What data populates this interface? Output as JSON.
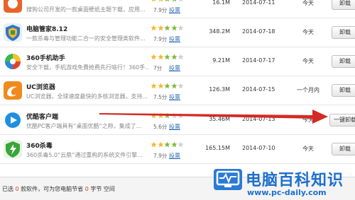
{
  "colors": {
    "accent_blue": "#1d6fce",
    "arrow_red": "#d42a23",
    "star_gold": "#f1b82d",
    "star_green": "#7dbb3a",
    "star_gray": "#cfcfcf",
    "vote_link": "#2e6bb5"
  },
  "apps": [
    {
      "icon": "sogou-browser-icon",
      "name": "",
      "desc": "搜狗公司开发的一款桌面壁纸主题下载，应用...",
      "score": "7.9分",
      "vote": "投票",
      "rating": 4,
      "size": "16.1M",
      "date": "2014-07-11",
      "last_used": "今天",
      "action": "卸载"
    },
    {
      "icon": "pc-manager-icon",
      "name": "电脑管家8.12",
      "desc": "一款杀毒与管理功能二合一的安全管理类软件...",
      "score": "7.9分",
      "vote": "投票",
      "rating": 4,
      "size": "348.2M",
      "date": "2014-07-18",
      "last_used": "今天",
      "action": "卸载"
    },
    {
      "icon": "360-mobile-assistant-icon",
      "name": "360手机助手",
      "desc": "安全下载，手机游戏免費抢费先行啥行！360手...",
      "score": "7分",
      "vote": "投票",
      "rating": 4,
      "size": "9.21M",
      "date": "2014-07-17",
      "last_used": "今天",
      "action": "卸载"
    },
    {
      "icon": "uc-browser-icon",
      "name": "UC浏览器",
      "desc": "UC浏览器，全球速度最快的多核浏览器，支持...",
      "score": "7.5分",
      "vote": "投票",
      "rating": 4,
      "size": "126.3M",
      "date": "2014-07-15",
      "last_used": "一个月内",
      "action": "卸载"
    },
    {
      "icon": "youku-client-icon",
      "name": "优酷客户端",
      "desc": "优酷PC客户端具有“桌面优酷”之称，集成了...",
      "score": "5.6分",
      "vote": "投票",
      "rating": 3,
      "size": "35.46M",
      "date": "2014-07-13",
      "last_used": "今天",
      "action": "一键卸载"
    },
    {
      "icon": "360-antivirus-icon",
      "name": "360杀毒",
      "desc": "360杀毒5.0“云鼎”通过重构的系统文件引擎...",
      "score": "7.9分",
      "vote": "投票",
      "rating": 4,
      "size": "165.15M",
      "date": "2014-07-10",
      "last_used": "今天",
      "action": "卸载"
    }
  ],
  "footer": {
    "status_prefix": "已选",
    "selected_count": "0",
    "status_mid": "款软件，可为您电脑节省",
    "saved_size": "0",
    "status_suffix": "字节 空间"
  },
  "watermark": {
    "title": "电脑百科知识",
    "url": "www.pc-daily.com",
    "logo_icon": "monitor-pulse-icon"
  }
}
